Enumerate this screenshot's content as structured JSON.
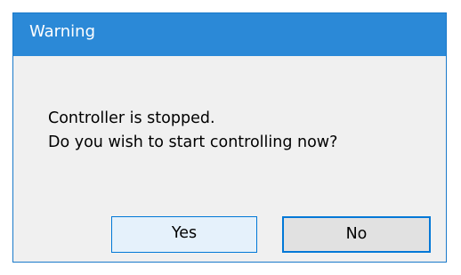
{
  "window": {
    "title": "Warning"
  },
  "message": {
    "line1": "Controller is stopped.",
    "line2": "Do you wish to start controlling now?"
  },
  "buttons": {
    "yes_label": "Yes",
    "no_label": "No",
    "default": "No"
  },
  "colors": {
    "titlebar": "#2b89d7",
    "title_text": "#ffffff",
    "dialog_bg": "#f0f0f0",
    "focus_border": "#0078d7"
  }
}
